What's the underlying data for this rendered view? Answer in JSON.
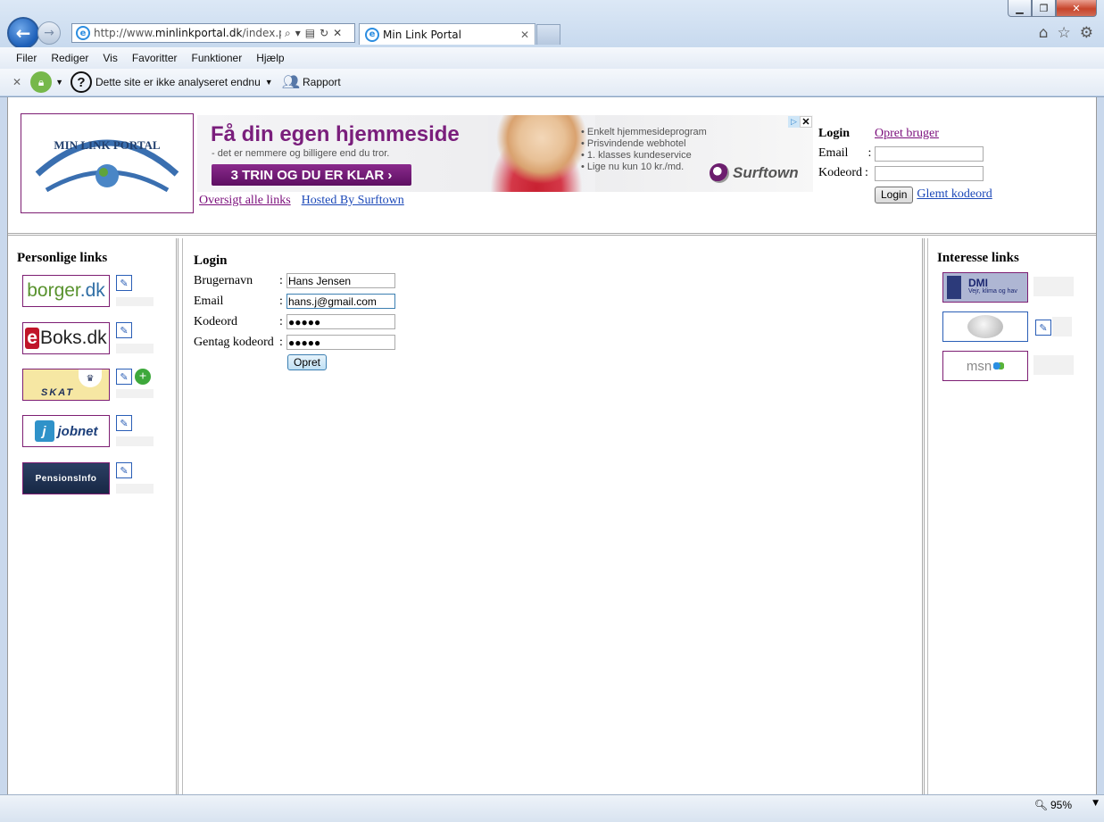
{
  "browser": {
    "address": {
      "prefix": "http://www.",
      "domain": "minlinkportal.dk",
      "path": "/index.php"
    },
    "tab_title": "Min Link Portal",
    "menu": [
      "Filer",
      "Rediger",
      "Vis",
      "Favoritter",
      "Funktioner",
      "Hjælp"
    ],
    "cmdbar": {
      "site_status": "Dette site er ikke analyseret endnu",
      "report": "Rapport"
    },
    "zoom": "95%"
  },
  "header": {
    "logo_text": "MIN LINK PORTAL",
    "ad": {
      "title": "Få din egen hjemmeside",
      "subtitle": "- det er nemmere og billigere end du tror.",
      "cta": "3 TRIN OG DU ER KLAR ›",
      "bullets": [
        "Enkelt hjemmesideprogram",
        "Prisvindende webhotel",
        "1. klasses kundeservice",
        "Lige nu kun 10 kr./md."
      ],
      "brand": "Surftown"
    },
    "links": {
      "overview": "Oversigt alle links",
      "hosted": "Hosted By Surftown"
    },
    "login": {
      "title": "Login",
      "create_user": "Opret bruger",
      "email_label": "Email",
      "password_label": "Kodeord",
      "colon": ":",
      "login_button": "Login",
      "forgot": "Glemt kodeord"
    }
  },
  "left": {
    "title": "Personlige links",
    "tiles": [
      {
        "name": "borger.dk"
      },
      {
        "name": "eBoks.dk"
      },
      {
        "name": "SKAT"
      },
      {
        "name": "jobnet"
      },
      {
        "name": "PensionsInfo"
      }
    ]
  },
  "right": {
    "title": "Interesse links",
    "tiles": [
      {
        "name": "DMI",
        "sub": "Vejr, klima og hav"
      },
      {
        "name": "Wikipedia"
      },
      {
        "name": "msn"
      }
    ]
  },
  "form": {
    "title": "Login",
    "fields": [
      {
        "label": "Brugernavn",
        "value": "Hans Jensen"
      },
      {
        "label": "Email",
        "value": "hans.j@gmail.com"
      },
      {
        "label": "Kodeord",
        "value": "●●●●●"
      },
      {
        "label": "Gentag kodeord",
        "value": "●●●●●"
      }
    ],
    "colon": ":",
    "submit": "Opret"
  },
  "colors": {
    "accent": "#7a1e7c",
    "link": "#1b48b8",
    "visited": "#7a0d7b"
  }
}
